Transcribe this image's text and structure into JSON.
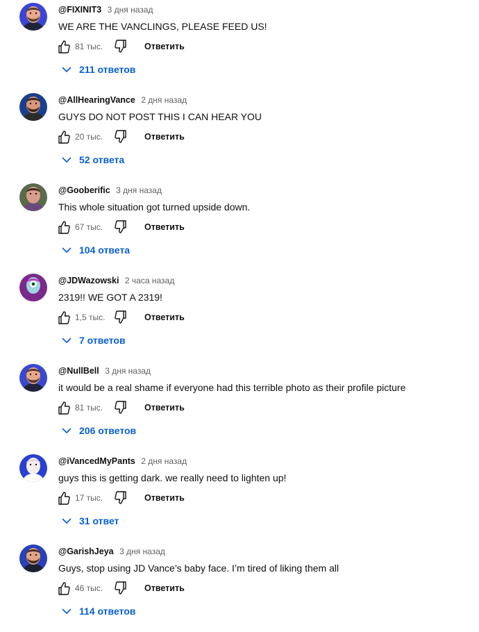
{
  "reply_label": "Ответить",
  "accent_color": "#065fd4",
  "comments": [
    {
      "author": "@FIXINIT3",
      "time": "3 дня назад",
      "text": "WE ARE THE VANCLINGS, PLEASE FEED US!",
      "likes": "81 тыс.",
      "replies": "211 ответов"
    },
    {
      "author": "@AllHearingVance",
      "time": "2 дня назад",
      "text": "GUYS DO NOT POST THIS I CAN HEAR YOU",
      "likes": "20 тыс.",
      "replies": "52 ответа"
    },
    {
      "author": "@Gooberific",
      "time": "3 дня назад",
      "text": "This whole situation got turned upside down.",
      "likes": "67 тыс.",
      "replies": "104 ответа"
    },
    {
      "author": "@JDWazowski",
      "time": "2 часа назад",
      "text": "2319!! WE GOT A 2319!",
      "likes": "1,5 тыс.",
      "replies": "7 ответов"
    },
    {
      "author": "@NullBell",
      "time": "3 дня назад",
      "text": "it would be a real shame if everyone had this terrible photo as their profile picture",
      "likes": "81 тыс.",
      "replies": "206 ответов"
    },
    {
      "author": "@iVancedMyPants",
      "time": "2 дня назад",
      "text": "guys this is getting dark. we really need to lighten up!",
      "likes": "17 тыс.",
      "replies": "31 ответ"
    },
    {
      "author": "@GarishJeya",
      "time": "3 дня назад",
      "text": "Guys, stop using JD Vance’s baby face. I’m tired of liking them all",
      "likes": "46 тыс.",
      "replies": "114 ответов"
    }
  ]
}
